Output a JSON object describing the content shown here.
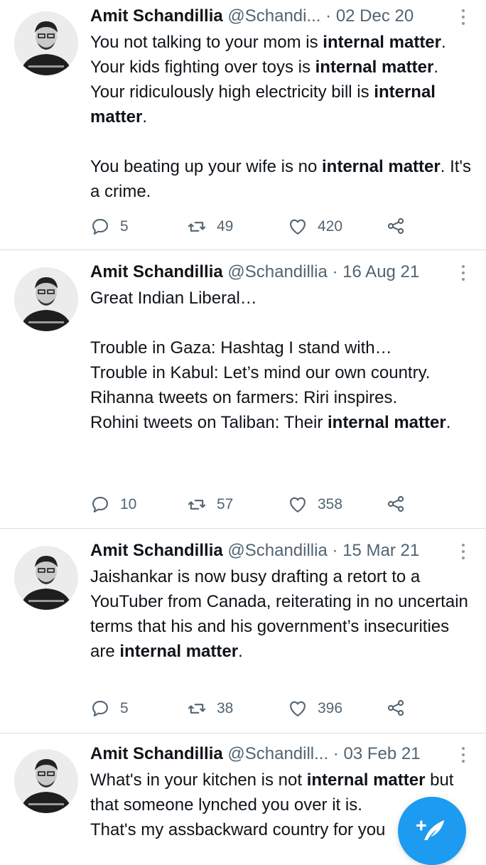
{
  "tweets": [
    {
      "name": "Amit Schandillia",
      "handle": "@Schandi...",
      "dot": " · ",
      "date": "02 Dec 20",
      "text": [
        {
          "t": "You not talking to your mom is ",
          "b": false
        },
        {
          "t": "internal matter",
          "b": true
        },
        {
          "t": ". Your kids fighting over toys is ",
          "b": false
        },
        {
          "t": "internal matter",
          "b": true
        },
        {
          "t": ". Your ridiculously high electricity bill is ",
          "b": false
        },
        {
          "t": "internal matter",
          "b": true
        },
        {
          "t": ".\n\nYou beating up your wife is no ",
          "b": false
        },
        {
          "t": "internal matter",
          "b": true
        },
        {
          "t": ". It's a crime.",
          "b": false
        }
      ],
      "replies": "5",
      "retweets": "49",
      "likes": "420"
    },
    {
      "name": "Amit Schandillia",
      "handle": "@Schandillia",
      "dot": " · ",
      "date": "16 Aug 21",
      "text": [
        {
          "t": "Great Indian Liberal…\n\nTrouble in Gaza: Hashtag I stand with…\nTrouble in Kabul: Let’s mind our own country.\nRihanna tweets on farmers: Riri inspires.\nRohini tweets on Taliban: Their ",
          "b": false
        },
        {
          "t": "internal matter",
          "b": true
        },
        {
          "t": ".",
          "b": false
        }
      ],
      "replies": "10",
      "retweets": "57",
      "likes": "358"
    },
    {
      "name": "Amit Schandillia",
      "handle": "@Schandillia",
      "dot": " · ",
      "date": "15 Mar 21",
      "text": [
        {
          "t": "Jaishankar is now busy drafting a retort to a YouTuber from Canada, reiterating in no uncertain terms that his and his government’s insecurities are ",
          "b": false
        },
        {
          "t": "internal matter",
          "b": true
        },
        {
          "t": ".",
          "b": false
        }
      ],
      "replies": "5",
      "retweets": "38",
      "likes": "396"
    },
    {
      "name": "Amit Schandillia",
      "handle": "@Schandill...",
      "dot": " · ",
      "date": "03 Feb 21",
      "text": [
        {
          "t": "What's in your kitchen is not ",
          "b": false
        },
        {
          "t": "internal matter",
          "b": true
        },
        {
          "t": " but that someone lynched you over it is.\nThat's my assbackward country for you",
          "b": false
        }
      ],
      "replies": "",
      "retweets": "",
      "likes": ""
    }
  ],
  "icons": {
    "reply": "reply-icon",
    "retweet": "retweet-icon",
    "like": "heart-icon",
    "share": "share-icon",
    "more": "more-vertical-icon",
    "compose": "compose-tweet-icon"
  },
  "colors": {
    "accent": "#1d9bf0",
    "muted": "#536471",
    "divider": "#d9dfe3"
  }
}
